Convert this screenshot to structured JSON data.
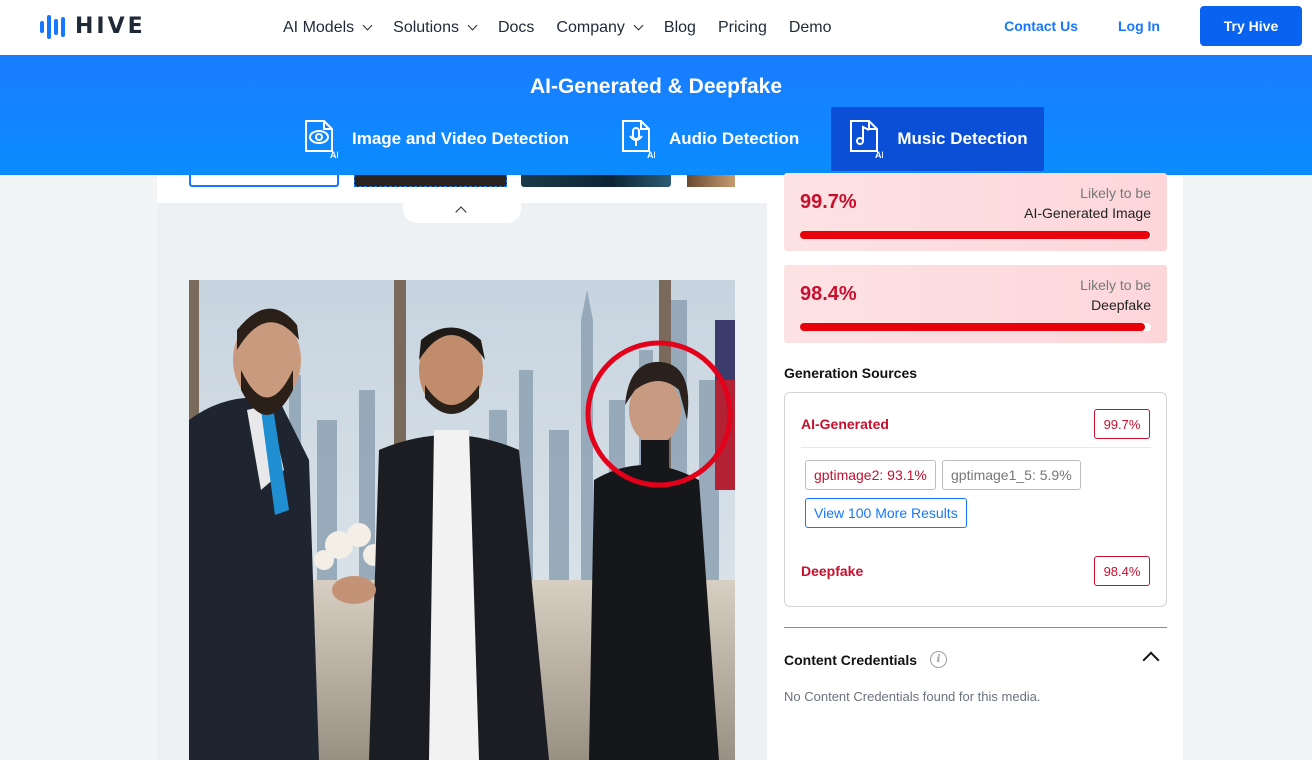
{
  "nav": {
    "logo_text": "HIVE",
    "menu": [
      {
        "label": "AI Models",
        "has_dropdown": true
      },
      {
        "label": "Solutions",
        "has_dropdown": true
      },
      {
        "label": "Docs",
        "has_dropdown": false
      },
      {
        "label": "Company",
        "has_dropdown": true
      },
      {
        "label": "Blog",
        "has_dropdown": false
      },
      {
        "label": "Pricing",
        "has_dropdown": false
      },
      {
        "label": "Demo",
        "has_dropdown": false
      }
    ],
    "contact_label": "Contact Us",
    "login_label": "Log In",
    "try_label": "Try Hive",
    "accent": "#1677ff"
  },
  "banner": {
    "title": "AI-Generated & Deepfake",
    "tabs": [
      {
        "label": "Image and Video Detection",
        "icon": "eye-file-icon",
        "active": false
      },
      {
        "label": "Audio Detection",
        "icon": "mic-file-icon",
        "active": false
      },
      {
        "label": "Music Detection",
        "icon": "music-file-icon",
        "active": true
      }
    ],
    "icon_badge": "AI"
  },
  "results": {
    "scores": [
      {
        "value": "99.7%",
        "likely": "Likely to be",
        "label": "AI-Generated Image",
        "fill": 0.997
      },
      {
        "value": "98.4%",
        "likely": "Likely to be",
        "label": "Deepfake",
        "fill": 0.984
      }
    ],
    "generation_sources": {
      "title": "Generation Sources",
      "ai_generated_label": "AI-Generated",
      "ai_generated_value": "99.7%",
      "chips": [
        "gptimage2: 93.1%",
        "gptimage1_5: 5.9%"
      ],
      "view_more": "View 100 More Results",
      "deepfake_label": "Deepfake",
      "deepfake_value": "98.4%"
    },
    "content_credentials": {
      "title": "Content Credentials",
      "note": "No Content Credentials found for this media."
    }
  },
  "colors": {
    "danger": "#c8102e",
    "banner": "#1a7cff",
    "active_tab": "#0b4fd6"
  }
}
